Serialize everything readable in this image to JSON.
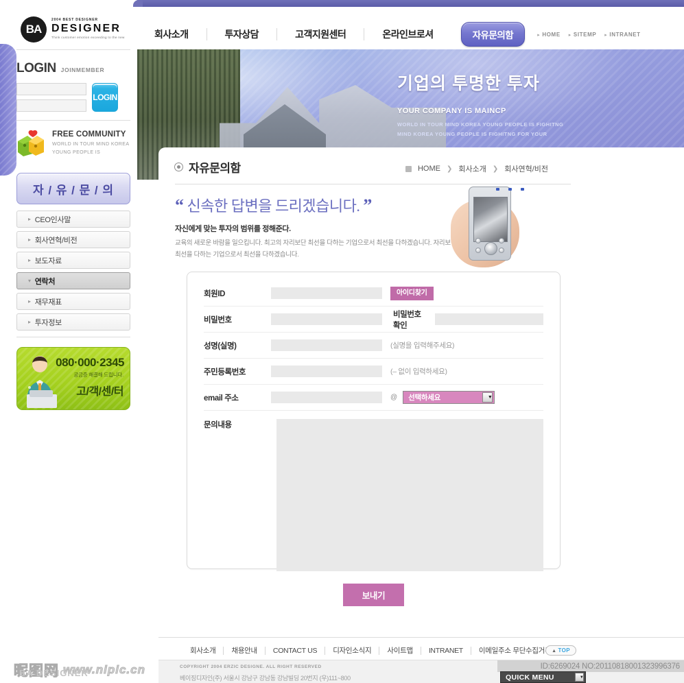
{
  "brand": {
    "mark": "BA",
    "tagline_top": "2004 BEST DESIGNER",
    "name": "DESIGNER",
    "tagline_bottom": "Think customer emotion\nexceeding to the new"
  },
  "nav": {
    "items": [
      {
        "label": "회사소개"
      },
      {
        "label": "투자상담"
      },
      {
        "label": "고객지원센터"
      },
      {
        "label": "온라인브로셔"
      }
    ],
    "active_pill": "자유문의함",
    "utility": [
      {
        "label": "HOME"
      },
      {
        "label": "SITEMP"
      },
      {
        "label": "INTRANET"
      }
    ]
  },
  "login": {
    "title": "LOGIN",
    "join_label": "JOINMEMBER",
    "id_placeholder": "",
    "pw_placeholder": "",
    "id_value": "",
    "pw_value": "",
    "button_label": "LOGIN"
  },
  "community": {
    "title": "FREE COMMUNITY",
    "line1": "WORLD IN TOUR MIND KOREA",
    "line2": "YOUNG  PEOPLE IS"
  },
  "sidebar": {
    "section_title": "자 / 유 / 문 / 의",
    "items": [
      {
        "label": "CEO인사말",
        "arrow": "▸",
        "active": false
      },
      {
        "label": "회사연혁/비전",
        "arrow": "▸",
        "active": false
      },
      {
        "label": "보도자료",
        "arrow": "▸",
        "active": false
      },
      {
        "label": "연락처",
        "arrow": "▾",
        "active": true
      },
      {
        "label": "재무재표",
        "arrow": "▸",
        "active": false
      },
      {
        "label": "투자정보",
        "arrow": "▸",
        "active": false
      }
    ]
  },
  "cs_banner": {
    "phone": "080·000·2345",
    "sub": "궁금증 해결해 드립니다.",
    "big": "고/객/센/터"
  },
  "hero": {
    "headline": "기업의 투명한 투자",
    "subhead": "YOUR COMPANY IS MAINCP",
    "line1": "WORLD IN TOUR MIND KOREA YOUNG PEOPLE IS FIGHITNG",
    "line2": "MIND KOREA YOUNG PEOPLE IS FIGHITNG FOR YOUR"
  },
  "page": {
    "title": "자유문의함",
    "breadcrumb": [
      {
        "label": "HOME"
      },
      {
        "label": "회사소개"
      },
      {
        "label": "회사연혁/비전"
      }
    ],
    "breadcrumb_sep": "❯"
  },
  "intro": {
    "quote_open": "“",
    "quote_text": "신속한 답변을 드리겠습니다.",
    "quote_close": "”",
    "bold_line": "자신에게 맞는 투자의 범위를 정해준다.",
    "body": "교육의 새로운 바람을 일으킵니다. 최고의 자리보단 최선을 다하는 기업으로서 최선을 다하겠습니다. 자리보단 최선을 다하는 기업으로서 최선을 다하겠습니다."
  },
  "form": {
    "rows": {
      "member_id": {
        "label": "회원ID",
        "value": "",
        "button": "아이디찾기"
      },
      "password": {
        "label": "비밀번호",
        "value": ""
      },
      "password_confirm": {
        "label": "비밀번호 확인",
        "value": ""
      },
      "name": {
        "label": "성명(실명)",
        "value": "",
        "hint": "(실명을 입력해주세요)"
      },
      "ssn": {
        "label": "주민등록번호",
        "value": "",
        "hint": "(– 없이 입력하세요)"
      },
      "email": {
        "label": "email 주소",
        "value": "",
        "at": "@",
        "select_value": "선택하세요",
        "caret": "▼"
      },
      "content": {
        "label": "문의내용",
        "value": ""
      }
    },
    "submit_label": "보내기"
  },
  "footer": {
    "links": [
      {
        "label": "회사소개"
      },
      {
        "label": "채용안내"
      },
      {
        "label": "CONTACT US"
      },
      {
        "label": "디자인소식지"
      },
      {
        "label": "사이트맵"
      },
      {
        "label": "INTRANET"
      },
      {
        "label": "이메일주소 무단수집거부"
      }
    ],
    "top_button": "TOP",
    "top_arrow": "▲",
    "copyright": "COPYRIGHT 2004 ERZIC DESIGNE. ALL RIGHT RESERVED",
    "address": "베이징디자인(주) 서울시 강남구 강남동 강남빌딩 20번지 (우)111~800"
  },
  "overlay": {
    "watermark_cn": "昵图网",
    "watermark_url": "www.nipic.cn",
    "watermark_brand": "BA DESIGNER",
    "id_tag": "ID:6269024 NO:20110818001323996376",
    "quick_menu": "QUICK MENU",
    "quick_caret": "▼"
  },
  "colors": {
    "purple": "#5f61c2",
    "pink": "#c36fad",
    "blue": "#1aa7dd",
    "green": "#a4d01e"
  }
}
